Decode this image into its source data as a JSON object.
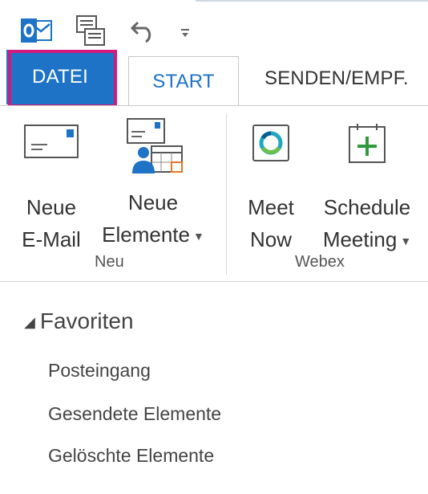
{
  "tabs": {
    "datei": "DATEI",
    "start": "START",
    "senden": "SENDEN/EMPF."
  },
  "ribbon": {
    "groups": [
      {
        "label": "Neu",
        "buttons": [
          {
            "line1": "Neue",
            "line2": "E-Mail"
          },
          {
            "line1": "Neue",
            "line2": "Elemente"
          }
        ]
      },
      {
        "label": "Webex",
        "buttons": [
          {
            "line1": "Meet",
            "line2": "Now"
          },
          {
            "line1": "Schedule",
            "line2": "Meeting"
          }
        ]
      }
    ]
  },
  "nav": {
    "favorites_label": "Favoriten",
    "items": [
      "Posteingang",
      "Gesendete Elemente",
      "Gelöschte Elemente"
    ]
  },
  "colors": {
    "accent": "#1e73c7",
    "highlight": "#d11a7c",
    "webex_plus": "#2e9a3b"
  },
  "icons": {
    "outlook": "outlook-logo-icon",
    "send_receive": "send-receive-all-icon",
    "undo": "undo-icon",
    "customize": "customize-qat-icon"
  }
}
